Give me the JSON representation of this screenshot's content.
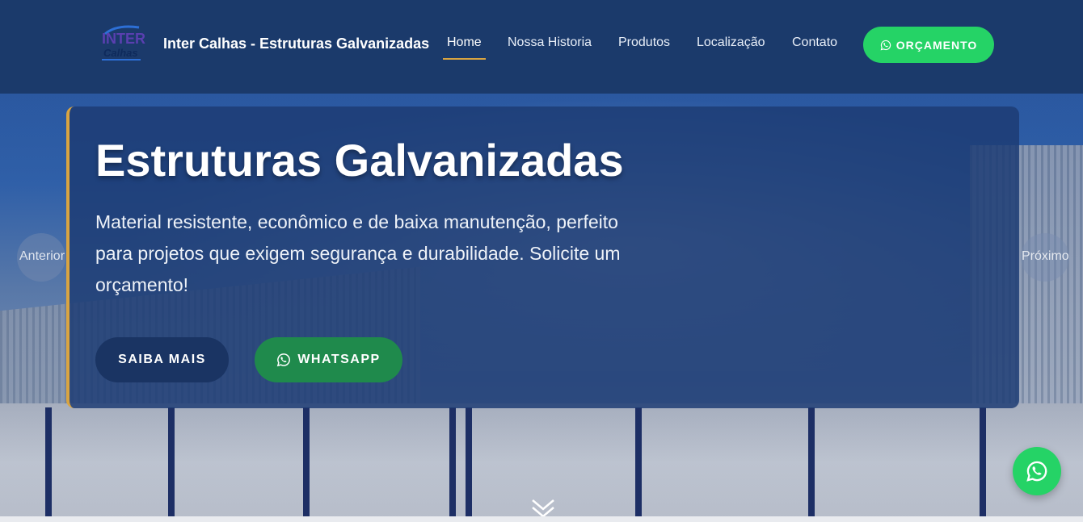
{
  "header": {
    "logo_text_top": "INTER",
    "logo_text_bottom": "Calhas",
    "brand": "Inter Calhas - Estruturas Galvanizadas",
    "nav": [
      {
        "label": "Home",
        "active": true
      },
      {
        "label": "Nossa Historia",
        "active": false
      },
      {
        "label": "Produtos",
        "active": false
      },
      {
        "label": "Localização",
        "active": false
      },
      {
        "label": "Contato",
        "active": false
      }
    ],
    "cta_label": "ORÇAMENTO",
    "cta_icon": "whatsapp-icon"
  },
  "hero": {
    "title": "Estruturas Galvanizadas",
    "text": "Material resistente, econômico e de baixa manutenção, perfeito para projetos que exigem segurança e durabilidade. Solicite um orçamento!",
    "primary_button": "SAIBA MAIS",
    "whatsapp_button": "WHATSAPP"
  },
  "slider": {
    "prev_label": "Anterior",
    "next_label": "Próximo"
  },
  "colors": {
    "header_bg": "#1b3a6b",
    "accent_gold": "#d9a441",
    "whatsapp_green": "#25d366",
    "whatsapp_dark_green": "#1f8a4c",
    "button_navy": "#1a3463"
  },
  "icons": {
    "floating": "whatsapp-icon",
    "scroll": "double-chevron-down-icon"
  }
}
